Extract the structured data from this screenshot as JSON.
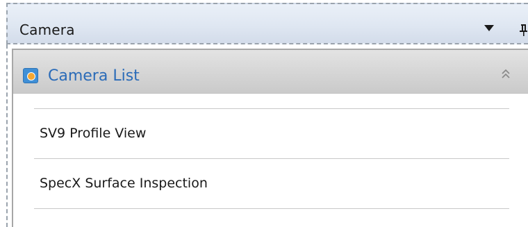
{
  "panel": {
    "title": "Camera"
  },
  "group": {
    "title": "Camera List",
    "items": [
      {
        "label": "SV9 Profile View"
      },
      {
        "label": "SpecX Surface Inspection"
      }
    ]
  },
  "icons": {
    "dropdown": "chevron-down-icon",
    "pin": "pin-icon",
    "camera": "camera-icon",
    "collapse": "double-chevron-up-icon"
  },
  "colors": {
    "group_title": "#2a6bb8",
    "camera_icon_bg": "#3f8fd6",
    "camera_icon_lens": "#f4a732",
    "titlebar_bg": "#dfe7f2",
    "group_header_bg": "#d4d4d4"
  }
}
